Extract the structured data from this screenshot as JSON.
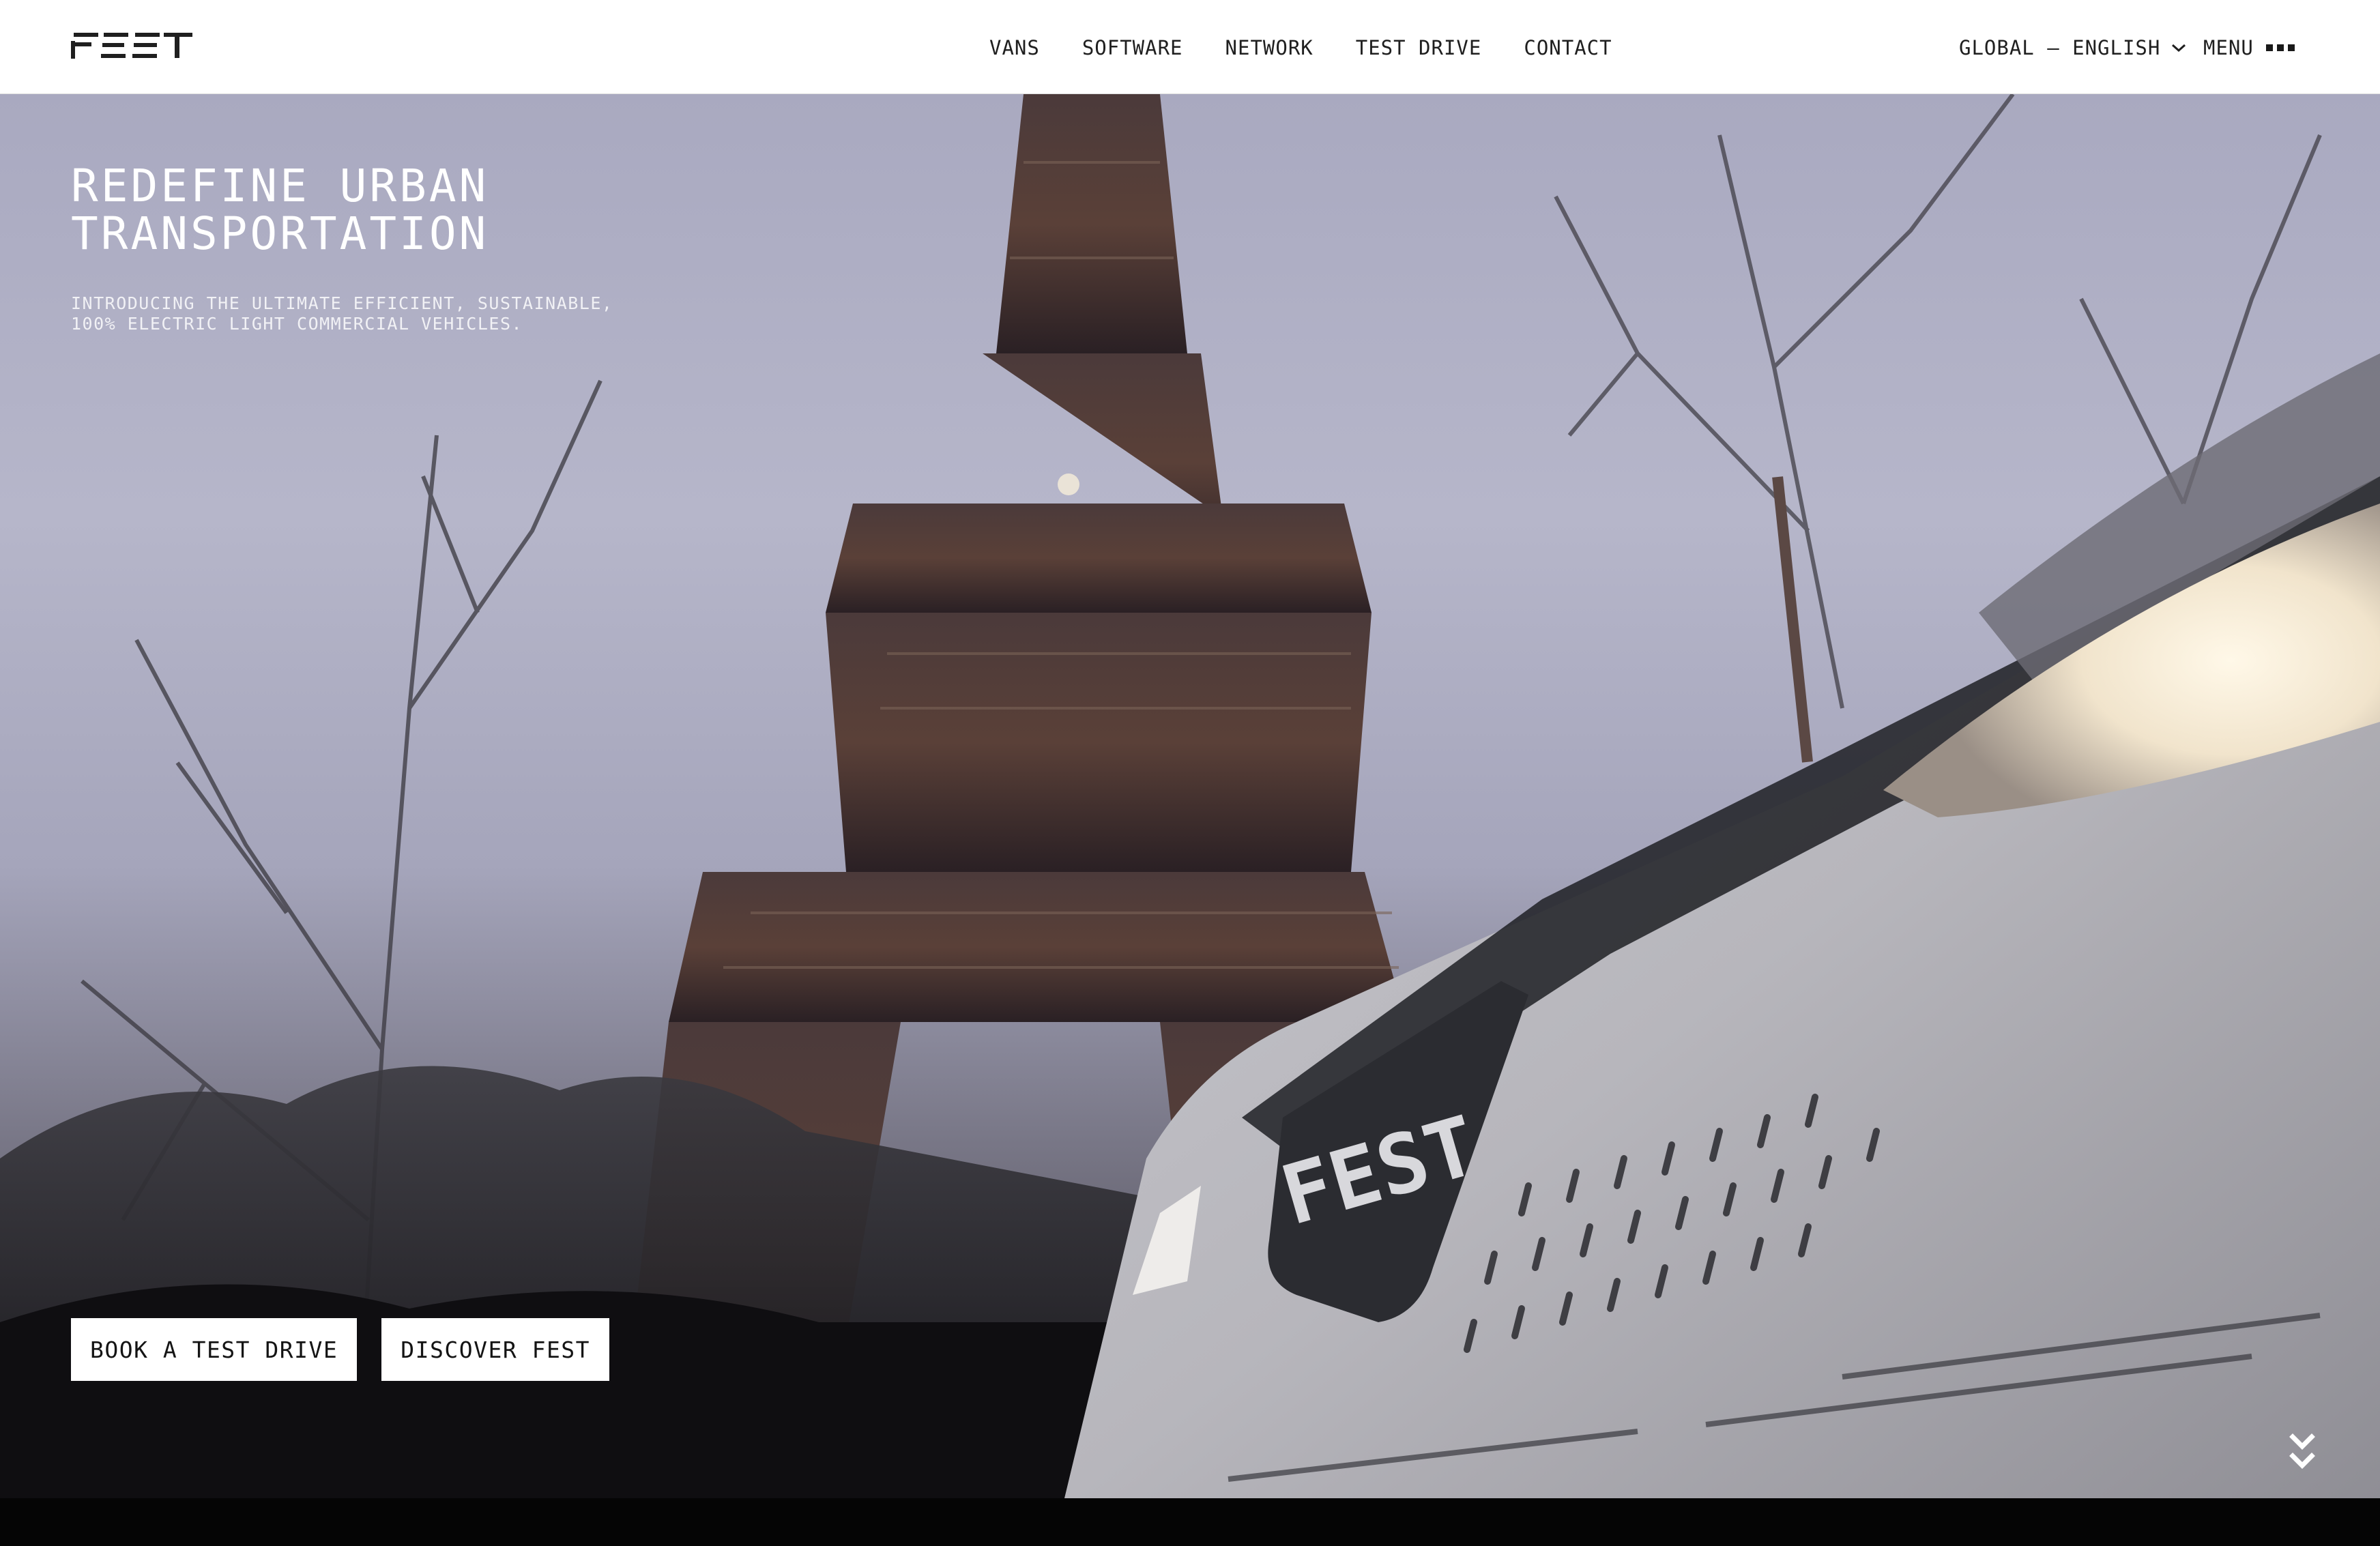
{
  "header": {
    "logo_text": "FEST",
    "nav": [
      {
        "label": "VANS"
      },
      {
        "label": "SOFTWARE"
      },
      {
        "label": "NETWORK"
      },
      {
        "label": "TEST DRIVE"
      },
      {
        "label": "CONTACT"
      }
    ],
    "language": {
      "label": "GLOBAL — ENGLISH",
      "icon": "chevron-down-icon"
    },
    "menu": {
      "label": "MENU",
      "icon": "dots-icon"
    }
  },
  "hero": {
    "headline_line1": "REDEFINE URBAN",
    "headline_line2": "TRANSPORTATION",
    "subline_line1": "INTRODUCING THE ULTIMATE EFFICIENT, SUSTAINABLE,",
    "subline_line2": "100% ELECTRIC LIGHT COMMERCIAL VEHICLES.",
    "badge_text": "FEST",
    "buttons": [
      {
        "label": "BOOK A TEST DRIVE"
      },
      {
        "label": "DISCOVER FEST"
      }
    ],
    "scroll_icon": "double-chevron-down-icon"
  },
  "colors": {
    "header_bg": "#ffffff",
    "text_dark": "#1f1f1f",
    "hero_text": "#ffffff",
    "footer_bg": "#050505"
  }
}
